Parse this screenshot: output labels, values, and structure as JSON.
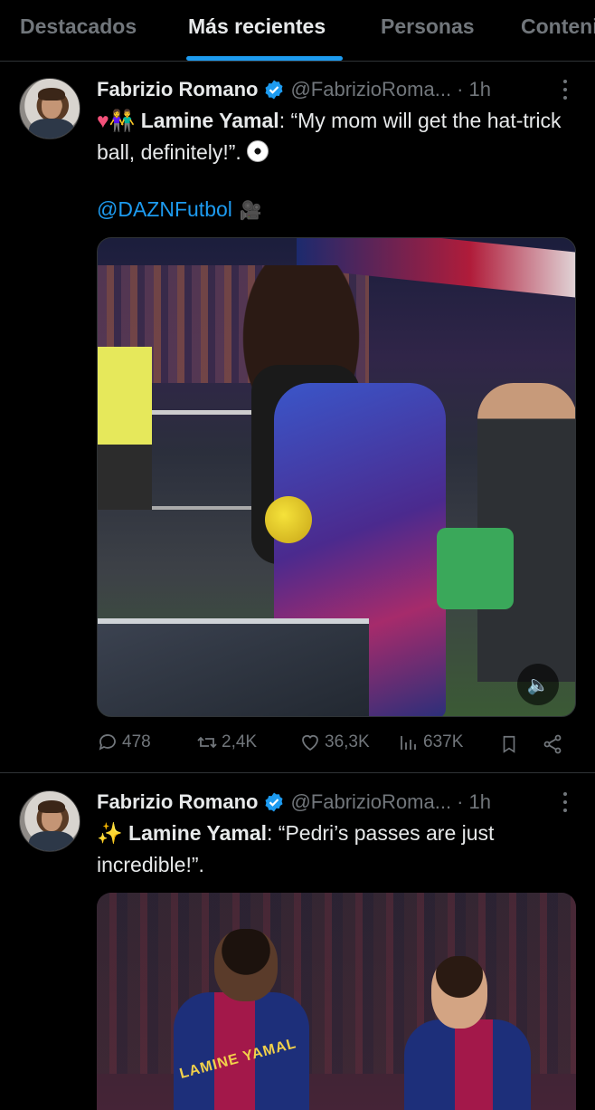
{
  "tabs": [
    {
      "label": "Destacados"
    },
    {
      "label": "Más recientes"
    },
    {
      "label": "Personas"
    },
    {
      "label": "Contenido"
    }
  ],
  "tweets": [
    {
      "name": "Fabrizio Romano",
      "handle": "@FabrizioRoma...",
      "time": "· 1h",
      "bold_name": "Lamine Yamal",
      "text_after": ": “My mom will get the hat-trick ball, definitely!”.",
      "mention": "@DAZNFutbol",
      "stats": {
        "replies": "478",
        "retweets": "2,4K",
        "likes": "36,3K",
        "views": "637K"
      }
    },
    {
      "name": "Fabrizio Romano",
      "handle": "@FabrizioRoma...",
      "time": "· 1h",
      "bold_name": "Lamine Yamal",
      "text_after": ": “Pedri’s passes are just incredible!”.",
      "jersey_text": "LAMINE YAMAL"
    }
  ],
  "colors": {
    "accent": "#1d9bf0",
    "background": "#000000",
    "muted": "#71767b"
  }
}
